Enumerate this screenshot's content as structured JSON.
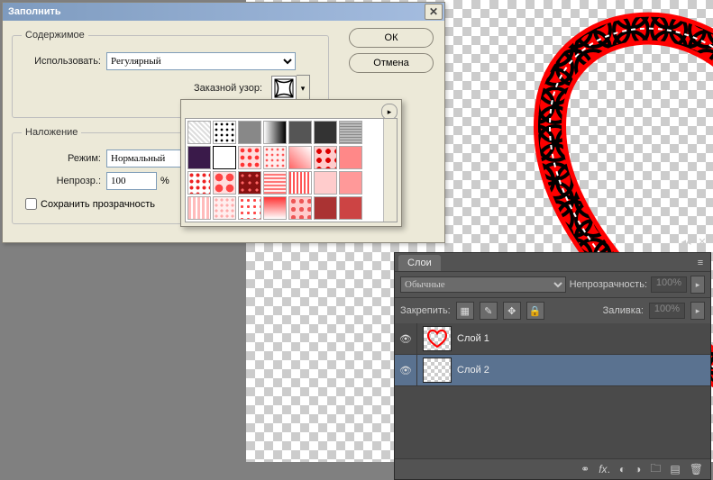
{
  "dialog": {
    "title": "Заполнить",
    "contents_legend": "Содержимое",
    "use_label": "Использовать:",
    "use_value": "Регулярный",
    "custom_pattern_label": "Заказной узор:",
    "blending_legend": "Наложение",
    "mode_label": "Режим:",
    "mode_value": "Нормальный",
    "opacity_label": "Непрозр.:",
    "opacity_value": "100",
    "opacity_unit": "%",
    "preserve_label": "Сохранить прозрачность",
    "ok_label": "ОК",
    "cancel_label": "Отмена"
  },
  "layers": {
    "tab": "Слои",
    "blend_value": "Обычные",
    "opacity_label": "Непрозрачность:",
    "opacity_value": "100%",
    "lock_label": "Закрепить:",
    "fill_label": "Заливка:",
    "fill_value": "100%",
    "items": [
      {
        "name": "Слой 1"
      },
      {
        "name": "Слой 2"
      }
    ]
  }
}
